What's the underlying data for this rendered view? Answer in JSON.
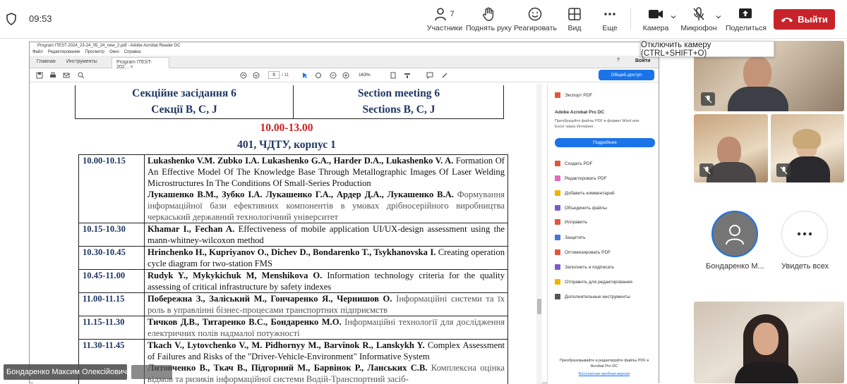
{
  "top": {
    "clock": "09:53",
    "participants": {
      "label": "Участники",
      "count": "7"
    },
    "raise_hand": "Поднять руку",
    "react": "Реагировать",
    "view": "Вид",
    "more": "Еще",
    "camera": "Камера",
    "microphone": "Микрофон",
    "share": "Поделиться",
    "leave": "Выйти",
    "tooltip": "Отключить камеру (CTRL+SHIFT+O)"
  },
  "acrobat": {
    "title": "Program ITEST-2024_23-24_05_24_new_2.pdf - Adobe Acrobat Reader DC",
    "menu": [
      "Файл",
      "Редактирование",
      "Просмотр",
      "Окно",
      "Справка"
    ],
    "tabs": [
      "Главная",
      "Инструменты",
      "Program ITEST-202..."
    ],
    "signin": "Войти",
    "page": "9",
    "pages": "/ 11",
    "zoom": "163%",
    "share_btn": "Общий доступ",
    "side": {
      "export": "Экспорт PDF",
      "pro_title": "Adobe Acrobat Pro DC",
      "pro_desc": "Преобразуйте файлы PDF в формат Word или Excel через Интернет",
      "more_btn": "Подробнее",
      "tools": [
        "Создать PDF",
        "Редактировать PDF",
        "Добавить комментарий",
        "Объединить файлы",
        "Исправить",
        "Защитить",
        "Оптимизировать PDF",
        "Заполнить и подписать",
        "Отправить для редактирования",
        "Дополнительные инструменты"
      ],
      "promo": "Преобразовывайте и редактируйте файлы PDF в Acrobat Pro DC",
      "trial": "Бесплатная пробная версия"
    }
  },
  "doc": {
    "section_uk": [
      "Секційне засідання 6",
      "Секції B, C, J"
    ],
    "section_en": [
      "Section meeting 6",
      "Sections B, C, J"
    ],
    "time_range": "10.00-13.00",
    "room": "401, ЧДТУ, корпус 1",
    "rows": [
      {
        "time": "10.00-10.15",
        "authors": "Lukashenko V.M. Zubko I.A. Lukashenko G.A., Harder D.A., Lukashenko V. A.",
        "title": " Formation Of An Effective Model Of The Knowledge Base Through Metallographic Images Of Laser Welding Microstructures In The Conditions Of Small-Series Production",
        "authors2": "Лукашенко В.М., Зубко І.А. Лукашенко Г.А., Ардер Д.А., Лукашенко В.А.",
        "title2": " Формування інформаційної бази ефективних компонентів в умовах дрібносерійного виробництва черкаський державний технологічний університет"
      },
      {
        "time": "10.15-10.30",
        "authors": "Khamar I., Fechan A.",
        "title": " Effectiveness of mobile application UI/UX-design assessment using the mann-whitney-wilcoxon method"
      },
      {
        "time": "10.30-10.45",
        "authors": "Hrinchenko H., Kupriyanov O., Dichev D., Bondarenko T., Tsykhanovska I.",
        "title": " Creating operation cycle diagram for two-station FMS"
      },
      {
        "time": "10.45-11.00",
        "authors": "Rudyk Y., Mykykichuk M, Menshikova O.",
        "title": " Information technology criteria for the quality assessing of critical infrastructure by safety indexes"
      },
      {
        "time": "11.00-11.15",
        "authors": "Побережна З., Заліський М., Гончаренко Я., Чернишов О.",
        "title": " Інформаційні системи та їх роль в управлінні бізнес-процесами транспортних підприємств"
      },
      {
        "time": "11.15-11.30",
        "authors": "Тичков Д.В., Титаренко В.С., Бондаренко М.О.",
        "title": " Інформаційні технології для дослідження електричних полів надмалої потужності"
      },
      {
        "time": "11.30-11.45",
        "authors": "Tkach V., Lytovchenko V., M. Pidhornyy M., Barvinok R., Lanskykh Y.",
        "title": " Complex Assessment of Failures and Risks of the \"Driver-Vehicle-Environment\" Informative System",
        "authors2": "Литовченко В., Ткач В., Підгорний М., Барвінок Р., Ланських С.В.",
        "title2": " Комплексна оцінка відмов та ризиків інформаційної системи Водій-Транспортний засіб-"
      }
    ]
  },
  "participants": {
    "tile_name": "Бондаренко М...",
    "see_all": "Увидеть всех",
    "self_name": "Бондаренко Максим Олексійович"
  }
}
